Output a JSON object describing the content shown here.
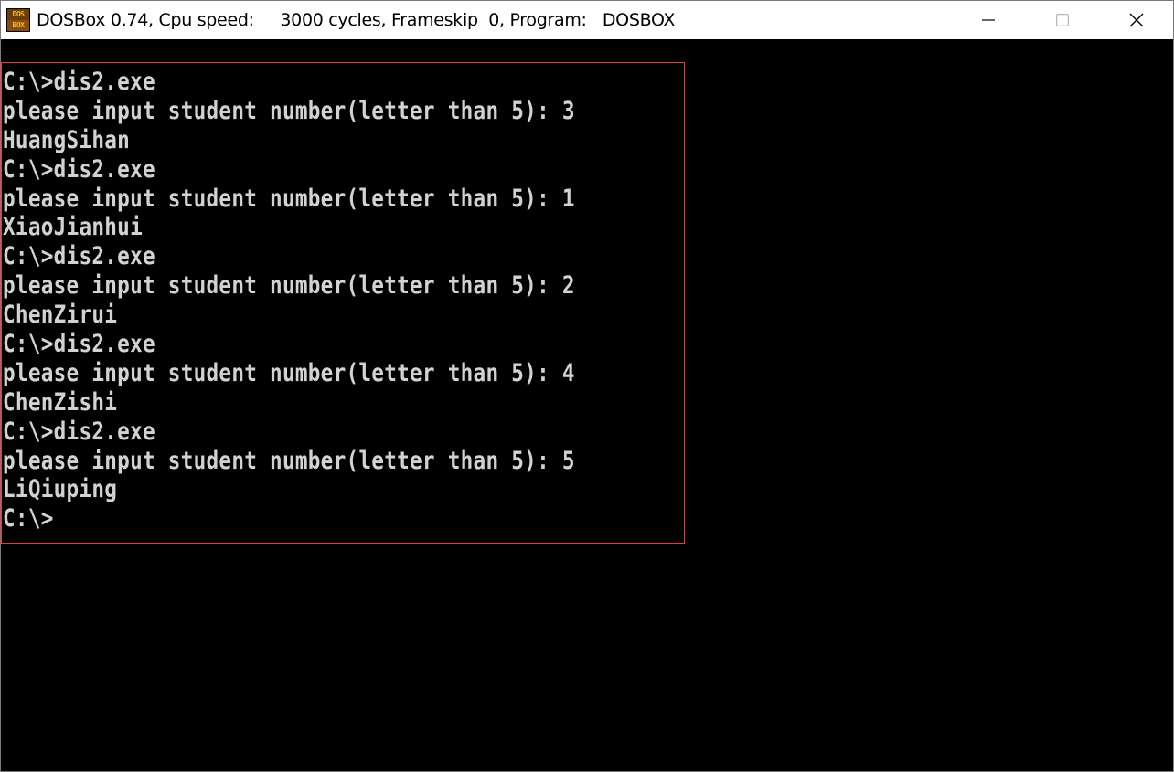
{
  "window": {
    "title": "DOSBox 0.74, Cpu speed:     3000 cycles, Frameskip  0, Program:   DOSBOX",
    "icon": {
      "name": "dosbox-icon",
      "top_text": "DOS",
      "bottom_text": "BOX"
    },
    "controls": {
      "minimize": "minimize-icon",
      "maximize": "maximize-icon",
      "close": "close-icon"
    }
  },
  "terminal": {
    "text_color": "#d2d2d2",
    "background": "#000000",
    "highlight_color": "#e0403a",
    "lines": [
      "C:\\>dis2.exe",
      "please input student number(letter than 5): 3",
      "HuangSihan",
      "C:\\>dis2.exe",
      "please input student number(letter than 5): 1",
      "XiaoJianhui",
      "C:\\>dis2.exe",
      "please input student number(letter than 5): 2",
      "ChenZirui",
      "C:\\>dis2.exe",
      "please input student number(letter than 5): 4",
      "ChenZishi",
      "C:\\>dis2.exe",
      "please input student number(letter than 5): 5",
      "LiQiuping",
      "C:\\>"
    ]
  }
}
